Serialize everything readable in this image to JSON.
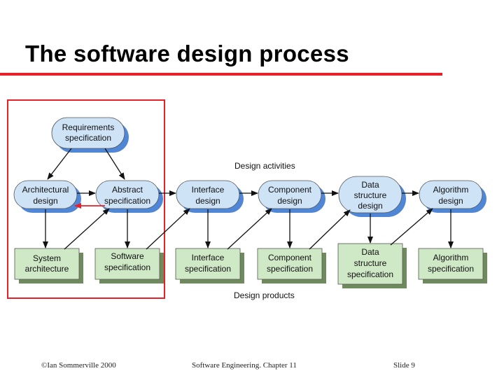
{
  "slide": {
    "title": "The software design process"
  },
  "diagram": {
    "activities_caption": "Design activities",
    "products_caption": "Design products",
    "requirements": [
      "Requirements",
      "specification"
    ],
    "activities": [
      {
        "id": "arch",
        "lines": [
          "Architectural",
          "design"
        ]
      },
      {
        "id": "abs",
        "lines": [
          "Abstract",
          "specification"
        ]
      },
      {
        "id": "iface",
        "lines": [
          "Interface",
          "design"
        ]
      },
      {
        "id": "comp",
        "lines": [
          "Component",
          "design"
        ]
      },
      {
        "id": "ds",
        "lines": [
          "Data",
          "structure",
          "design"
        ]
      },
      {
        "id": "algo",
        "lines": [
          "Algorithm",
          "design"
        ]
      }
    ],
    "products": [
      {
        "id": "sys",
        "lines": [
          "System",
          "architecture"
        ]
      },
      {
        "id": "sws",
        "lines": [
          "Software",
          "specification"
        ]
      },
      {
        "id": "ifs",
        "lines": [
          "Interface",
          "specification"
        ]
      },
      {
        "id": "cps",
        "lines": [
          "Component",
          "specification"
        ]
      },
      {
        "id": "dss",
        "lines": [
          "Data",
          "structure",
          "specification"
        ]
      },
      {
        "id": "als",
        "lines": [
          "Algorithm",
          "specification"
        ]
      }
    ],
    "colors": {
      "activity_fill": "#cfe3f7",
      "activity_shadow": "#4f87d6",
      "product_fill": "#cfe8c6",
      "product_shadow": "#6f8a5c",
      "highlight": "#e8202a"
    }
  },
  "footer": {
    "copyright": "©Ian Sommerville 2000",
    "course": "Software Engineering. Chapter 11",
    "slide": "Slide 9"
  }
}
